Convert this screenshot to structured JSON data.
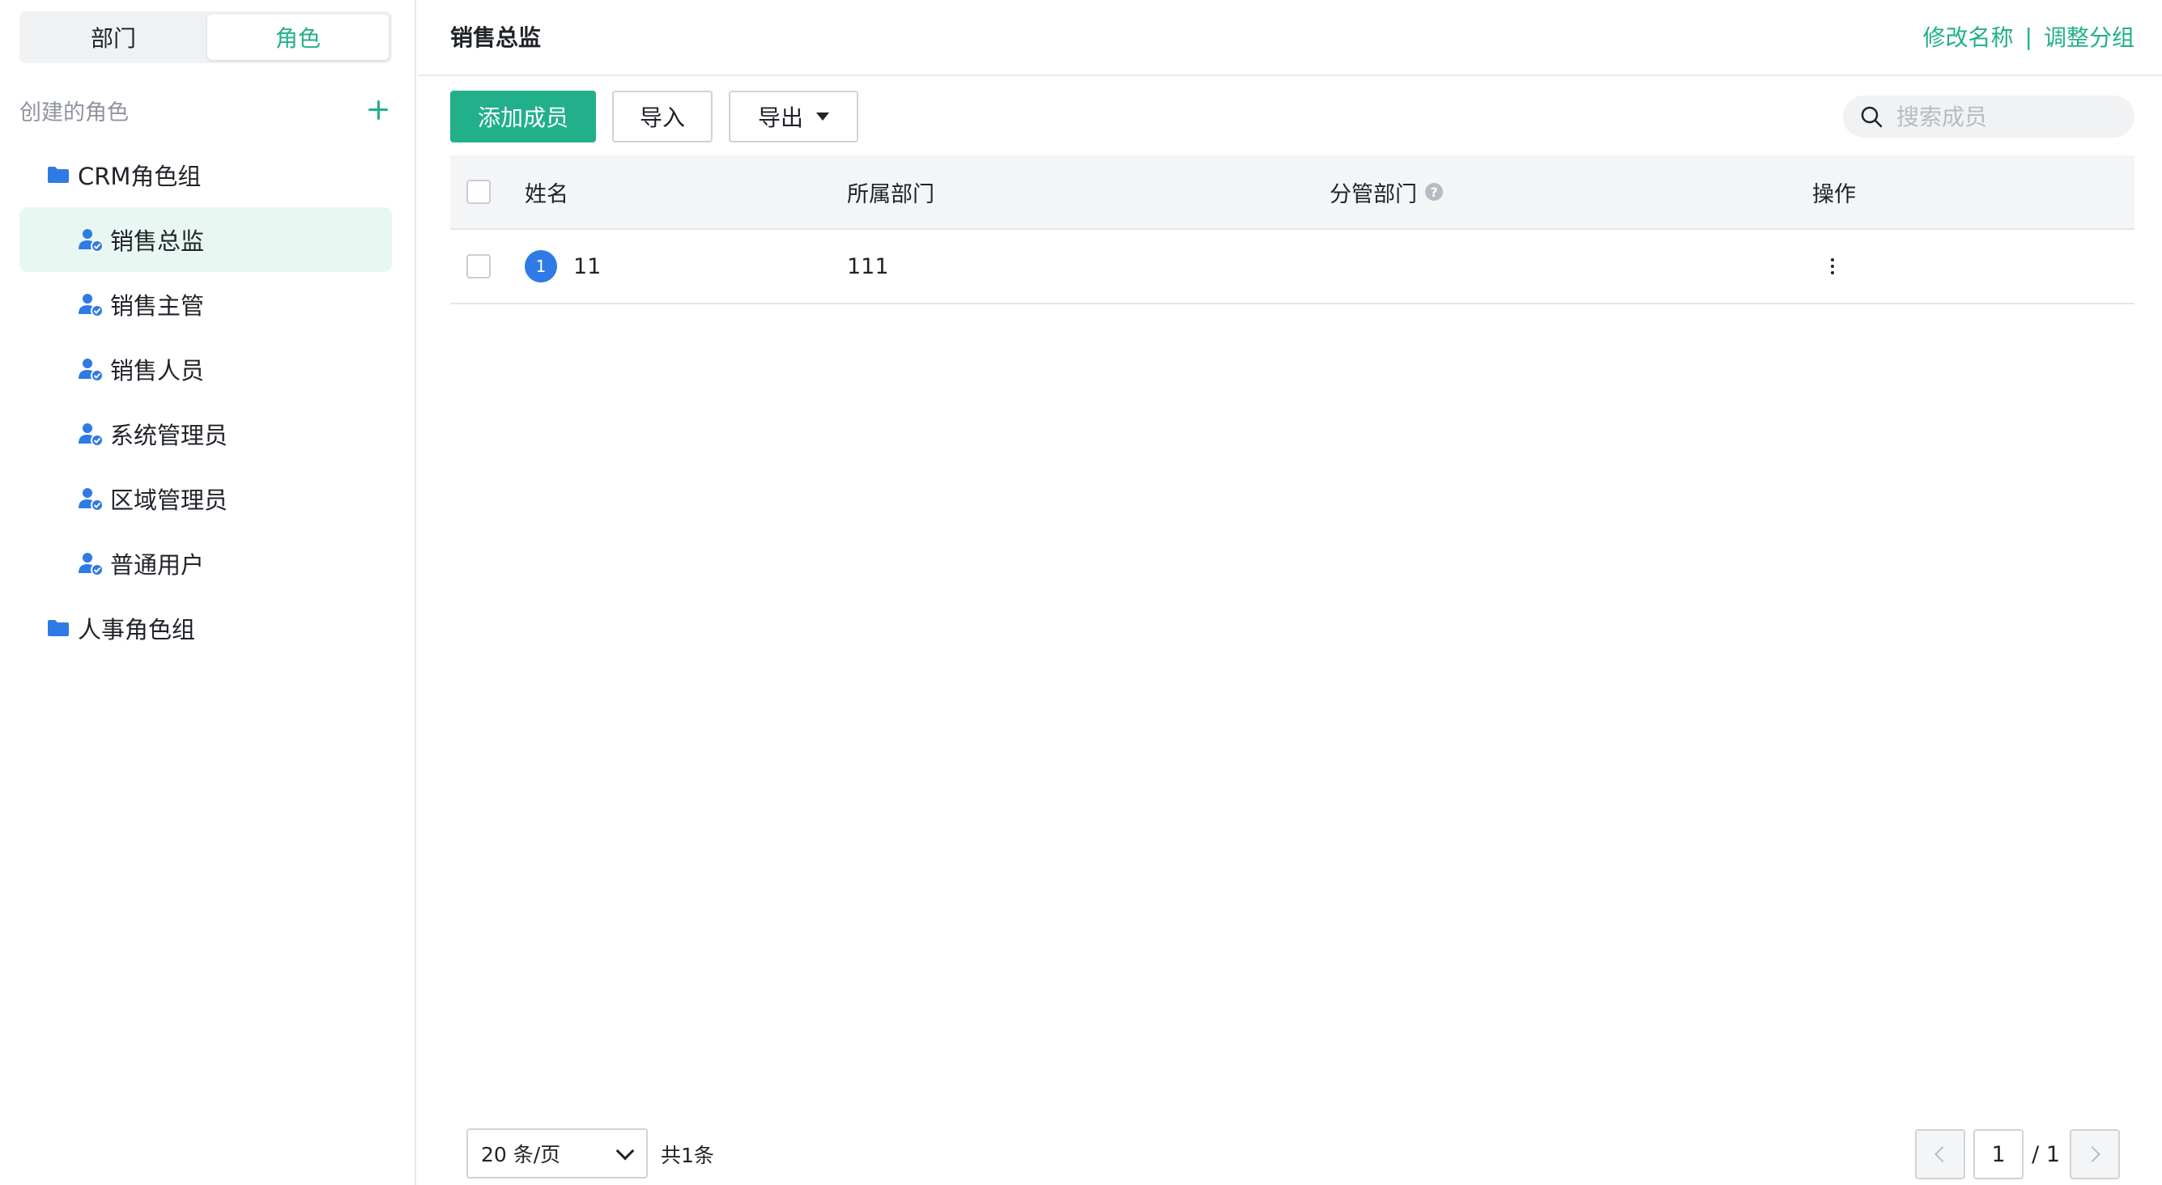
{
  "sidebar": {
    "tabs": {
      "dept": "部门",
      "role": "角色"
    },
    "created_title": "创建的角色",
    "groups": [
      {
        "label": "CRM角色组"
      },
      {
        "label": "人事角色组"
      }
    ],
    "roles": [
      {
        "label": "销售总监",
        "active": true
      },
      {
        "label": "销售主管"
      },
      {
        "label": "销售人员"
      },
      {
        "label": "系统管理员"
      },
      {
        "label": "区域管理员"
      },
      {
        "label": "普通用户"
      }
    ]
  },
  "header": {
    "title": "销售总监",
    "rename": "修改名称",
    "separator": "|",
    "regroup": "调整分组"
  },
  "toolbar": {
    "add_member": "添加成员",
    "import": "导入",
    "export": "导出",
    "search_placeholder": "搜索成员"
  },
  "table": {
    "columns": {
      "name": "姓名",
      "dept": "所属部门",
      "managed_dept": "分管部门",
      "ops": "操作"
    },
    "help_glyph": "?",
    "rows": [
      {
        "avatar": "1",
        "name": "11",
        "dept": "111",
        "managed_dept": ""
      }
    ]
  },
  "footer": {
    "page_size": "20 条/页",
    "total": "共1条",
    "current_page": "1",
    "total_pages": "/ 1"
  },
  "colors": {
    "accent": "#22b08b",
    "avatar": "#2f7ae5",
    "role_icon": "#2f7ae5"
  }
}
